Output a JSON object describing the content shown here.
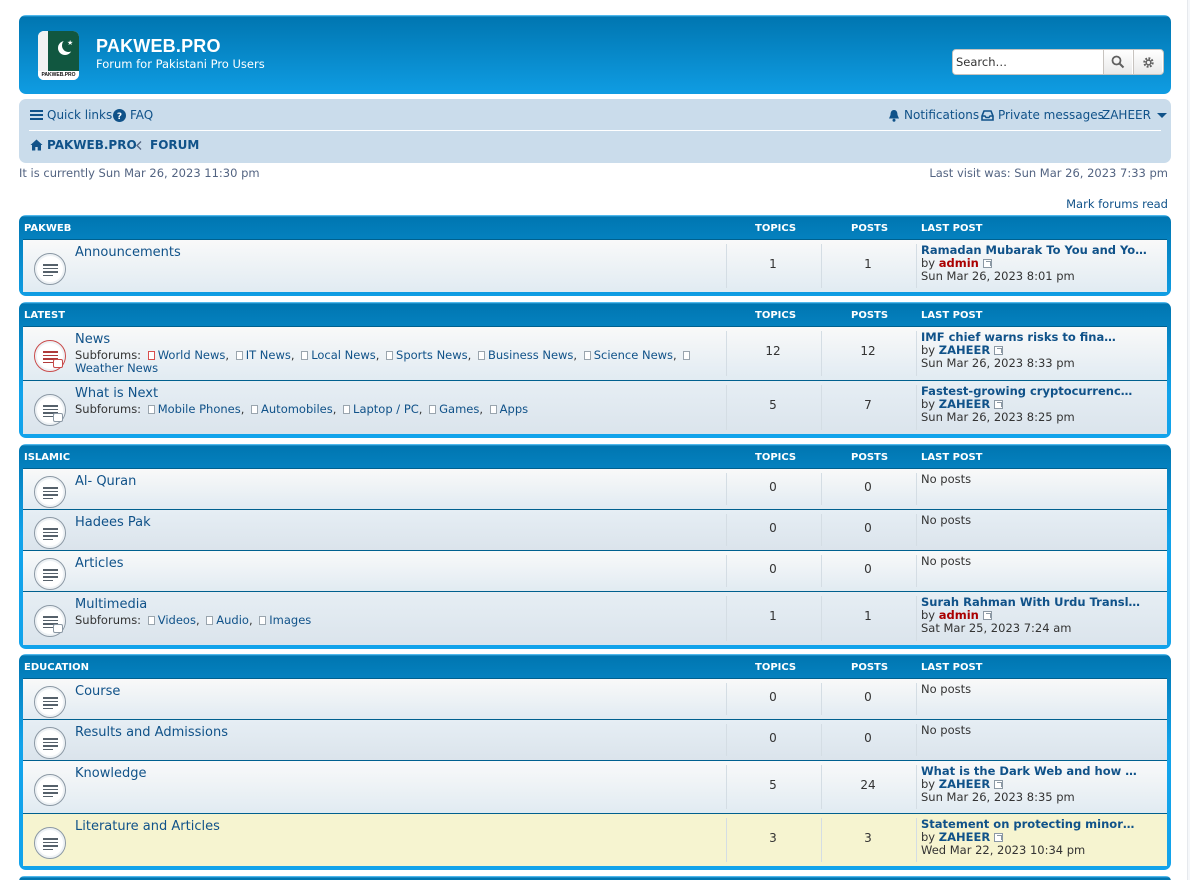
{
  "header": {
    "logo_caption": "PAKWEB.PRO",
    "site_title": "PAKWEB.PRO",
    "site_description": "Forum for Pakistani Pro Users",
    "search_placeholder": "Search…"
  },
  "nav": {
    "quick_links": "Quick links",
    "faq": "FAQ",
    "notifications": "Notifications",
    "private_messages": "Private messages",
    "username": "ZAHEER",
    "breadcrumb": [
      "PAKWEB.PRO",
      "FORUM"
    ]
  },
  "status": {
    "current_time": "It is currently Sun Mar 26, 2023 11:30 pm",
    "last_visit": "Last visit was: Sun Mar 26, 2023 7:33 pm",
    "mark_read": "Mark forums read"
  },
  "columns": {
    "topics": "TOPICS",
    "posts": "POSTS",
    "last_post": "LAST POST"
  },
  "categories": [
    {
      "name": "PAKWEB",
      "forums": [
        {
          "title": "Announcements",
          "topics": "1",
          "posts": "1",
          "last_title": "Ramadan Mubarak To You and Yo…",
          "by": "by",
          "last_user": "admin",
          "last_date": "Sun Mar 26, 2023 8:01 pm"
        }
      ]
    },
    {
      "name": "LATEST",
      "forums": [
        {
          "title": "News",
          "subforums_label": "Subforums:",
          "subforums": [
            "World News",
            "IT News",
            "Local News",
            "Sports News",
            "Business News",
            "Science News",
            "Weather News"
          ],
          "topics": "12",
          "posts": "12",
          "last_title": "IMF chief warns risks to fina…",
          "by": "by",
          "last_user": "ZAHEER",
          "last_date": "Sun Mar 26, 2023 8:33 pm"
        },
        {
          "title": "What is Next",
          "subforums_label": "Subforums:",
          "subforums": [
            "Mobile Phones",
            "Automobiles",
            "Laptop / PC",
            "Games",
            "Apps"
          ],
          "topics": "5",
          "posts": "7",
          "last_title": "Fastest-growing cryptocurrenc…",
          "by": "by",
          "last_user": "ZAHEER",
          "last_date": "Sun Mar 26, 2023 8:25 pm"
        }
      ]
    },
    {
      "name": "ISLAMIC",
      "forums": [
        {
          "title": "Al- Quran",
          "topics": "0",
          "posts": "0",
          "no_posts": "No posts"
        },
        {
          "title": "Hadees Pak",
          "topics": "0",
          "posts": "0",
          "no_posts": "No posts"
        },
        {
          "title": "Articles",
          "topics": "0",
          "posts": "0",
          "no_posts": "No posts"
        },
        {
          "title": "Multimedia",
          "subforums_label": "Subforums:",
          "subforums": [
            "Videos",
            "Audio",
            "Images"
          ],
          "topics": "1",
          "posts": "1",
          "last_title": "Surah Rahman With Urdu Transl…",
          "by": "by",
          "last_user": "admin",
          "last_date": "Sat Mar 25, 2023 7:24 am"
        }
      ]
    },
    {
      "name": "EDUCATION",
      "forums": [
        {
          "title": "Course",
          "topics": "0",
          "posts": "0",
          "no_posts": "No posts"
        },
        {
          "title": "Results and Admissions",
          "topics": "0",
          "posts": "0",
          "no_posts": "No posts"
        },
        {
          "title": "Knowledge",
          "topics": "5",
          "posts": "24",
          "last_title": "What is the Dark Web and how …",
          "by": "by",
          "last_user": "ZAHEER",
          "last_date": "Sun Mar 26, 2023 8:35 pm"
        },
        {
          "title": "Literature and Articles",
          "topics": "3",
          "posts": "3",
          "last_title": "Statement on protecting minor…",
          "by": "by",
          "last_user": "ZAHEER",
          "last_date": "Wed Mar 22, 2023 10:34 pm"
        }
      ]
    }
  ]
}
